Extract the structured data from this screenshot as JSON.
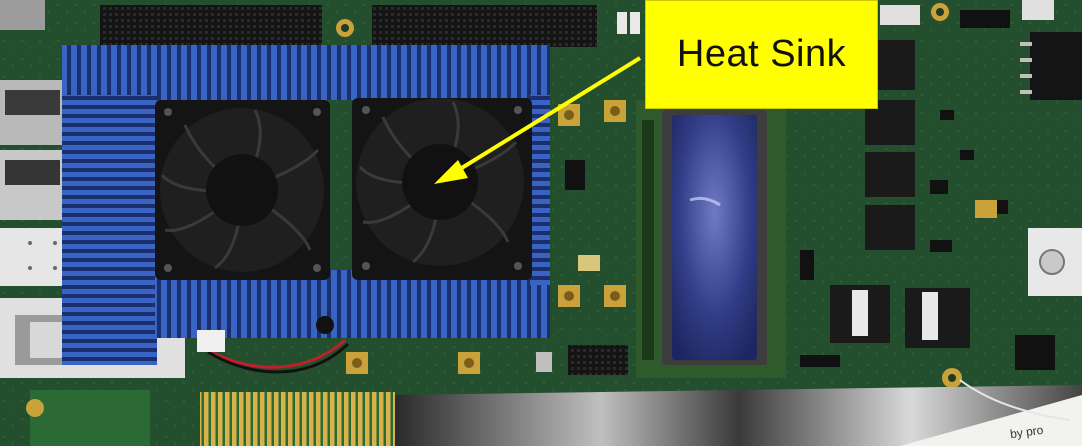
{
  "image": {
    "subject": "circuit-board-photo",
    "callout": {
      "text": "Heat Sink",
      "background": "#ffff00",
      "arrow_color": "#ffff00"
    },
    "board_labels": {
      "paper_note": "by pro"
    },
    "colors": {
      "pcb": "#1f4a2a",
      "heat_sink": "#2f55b0",
      "fan": "#1a1a1a",
      "gold": "#c9a23a",
      "lcd": "#24306a"
    }
  }
}
